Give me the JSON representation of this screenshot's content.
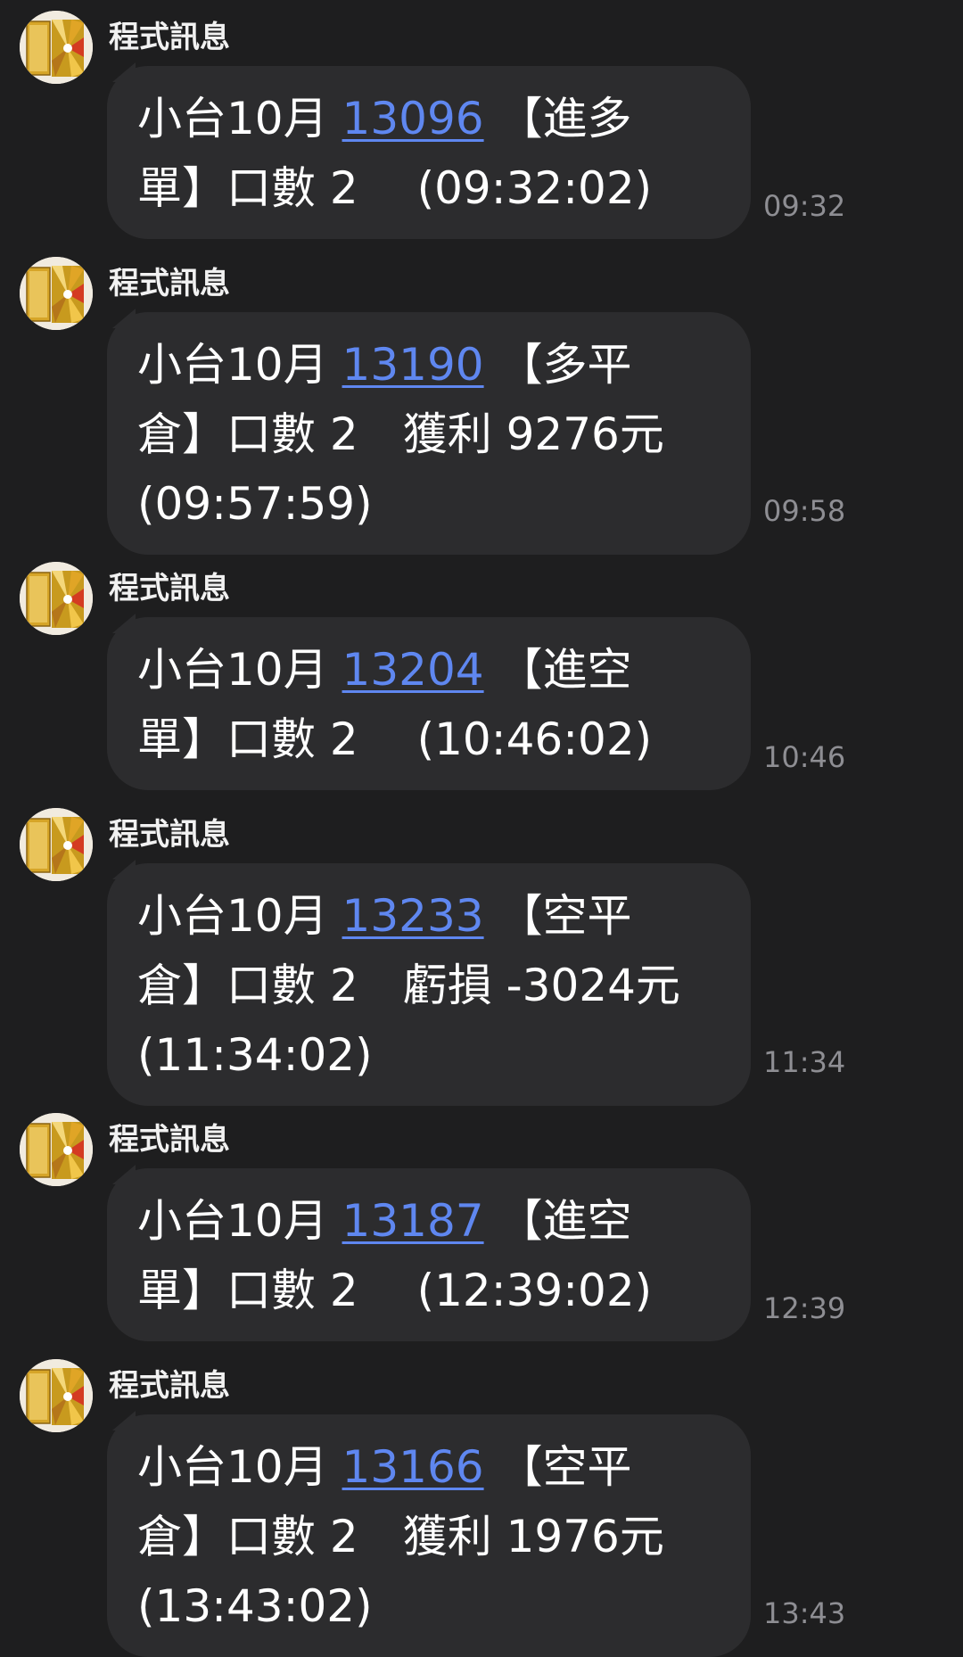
{
  "messages": [
    {
      "sender": "程式訊息",
      "lines": [
        {
          "pre": "小台10月 ",
          "price": "13096",
          "post": " 【進多"
        },
        {
          "text": "單】口數 2　 (09:32:02)"
        }
      ],
      "time": "09:32"
    },
    {
      "sender": "程式訊息",
      "lines": [
        {
          "pre": "小台10月 ",
          "price": "13190",
          "post": " 【多平"
        },
        {
          "text": "倉】口數 2　獲利 9276元"
        },
        {
          "text": "(09:57:59)"
        }
      ],
      "time": "09:58"
    },
    {
      "sender": "程式訊息",
      "lines": [
        {
          "pre": "小台10月 ",
          "price": "13204",
          "post": " 【進空"
        },
        {
          "text": "單】口數 2　 (10:46:02)"
        }
      ],
      "time": "10:46"
    },
    {
      "sender": "程式訊息",
      "lines": [
        {
          "pre": "小台10月 ",
          "price": "13233",
          "post": " 【空平"
        },
        {
          "text": "倉】口數 2　虧損 -3024元"
        },
        {
          "text": "(11:34:02)"
        }
      ],
      "time": "11:34"
    },
    {
      "sender": "程式訊息",
      "lines": [
        {
          "pre": "小台10月 ",
          "price": "13187",
          "post": " 【進空"
        },
        {
          "text": "單】口數 2　 (12:39:02)"
        }
      ],
      "time": "12:39"
    },
    {
      "sender": "程式訊息",
      "lines": [
        {
          "pre": "小台10月 ",
          "price": "13166",
          "post": " 【空平"
        },
        {
          "text": "倉】口數 2　獲利 1976元"
        },
        {
          "text": "(13:43:02)"
        }
      ],
      "time": "13:43"
    }
  ]
}
